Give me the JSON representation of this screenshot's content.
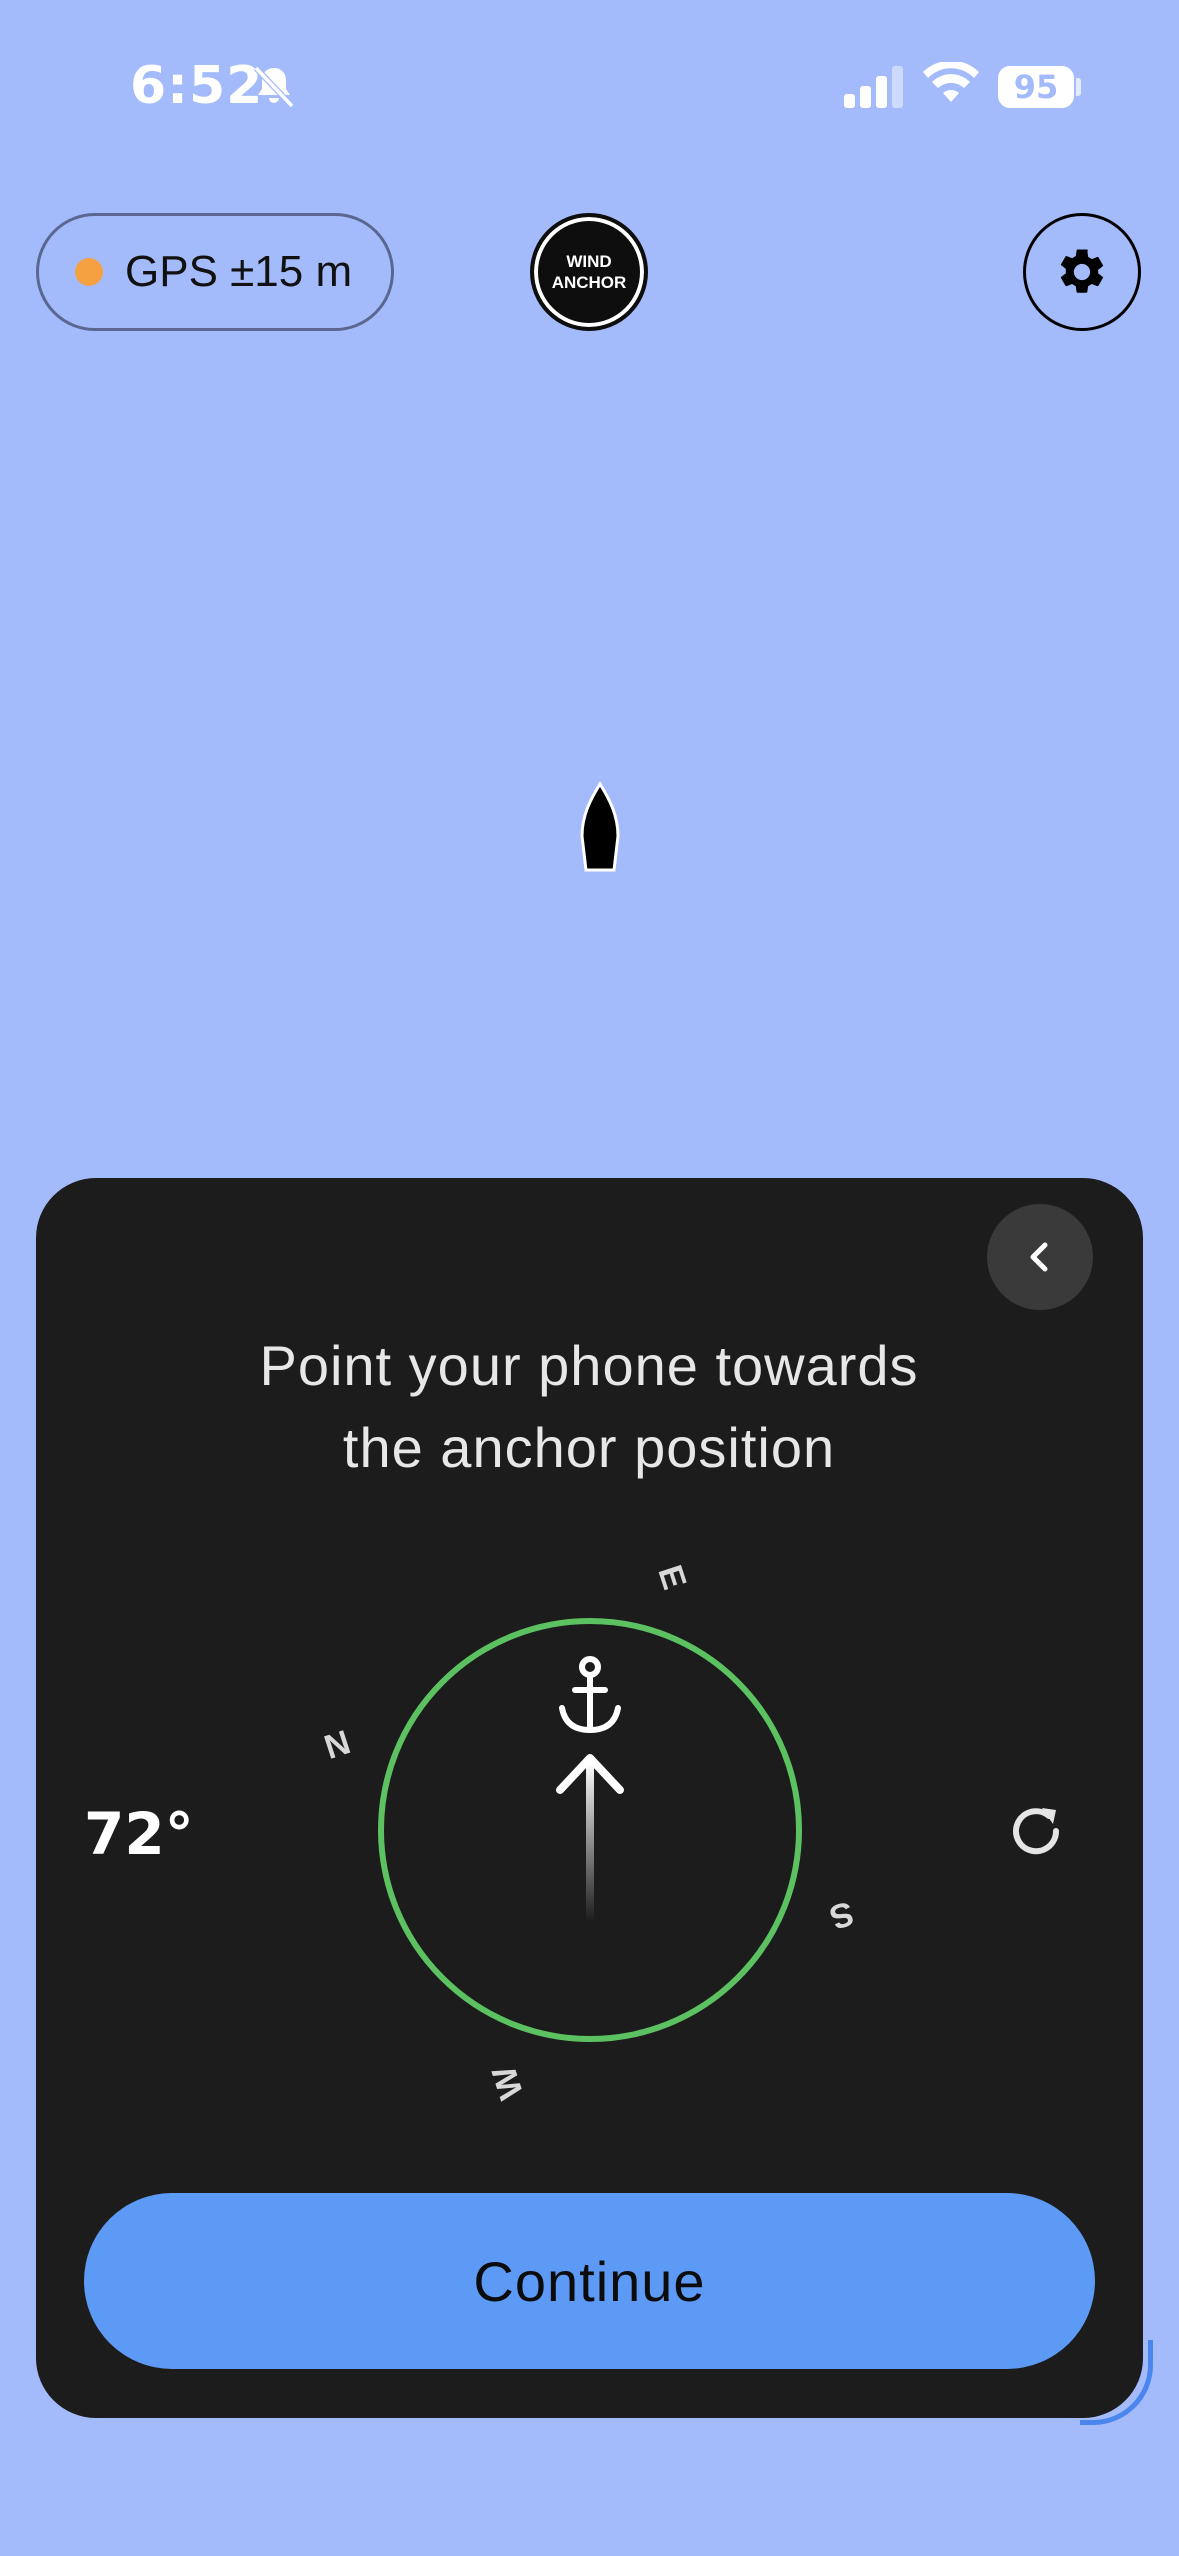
{
  "status_bar": {
    "time": "6:52",
    "battery": "95",
    "icons": [
      "bell-slash-icon",
      "cellular-signal-icon",
      "wifi-icon",
      "battery-icon"
    ]
  },
  "top_bar": {
    "gps_label": "GPS ±15 m",
    "gps_status_color": "#f5a142",
    "logo_line1": "WIND",
    "logo_line2": "ANCHOR",
    "settings_icon": "gear-icon"
  },
  "map": {
    "vessel_icon": "boat-icon"
  },
  "panel": {
    "back_icon": "chevron-left-icon",
    "prompt_line1": "Point your phone towards",
    "prompt_line2": "the anchor position",
    "heading": "72°",
    "refresh_icon": "rotate-right-icon",
    "compass": {
      "labels": {
        "n": "N",
        "e": "E",
        "s": "S",
        "w": "W"
      },
      "ring_color": "#5cc160",
      "anchor_icon": "anchor-icon",
      "arrow_icon": "arrow-up-icon"
    },
    "continue_label": "Continue"
  },
  "colors": {
    "background": "#a4bbfb",
    "panel": "#1c1c1c",
    "primary_button": "#5d9af5"
  }
}
